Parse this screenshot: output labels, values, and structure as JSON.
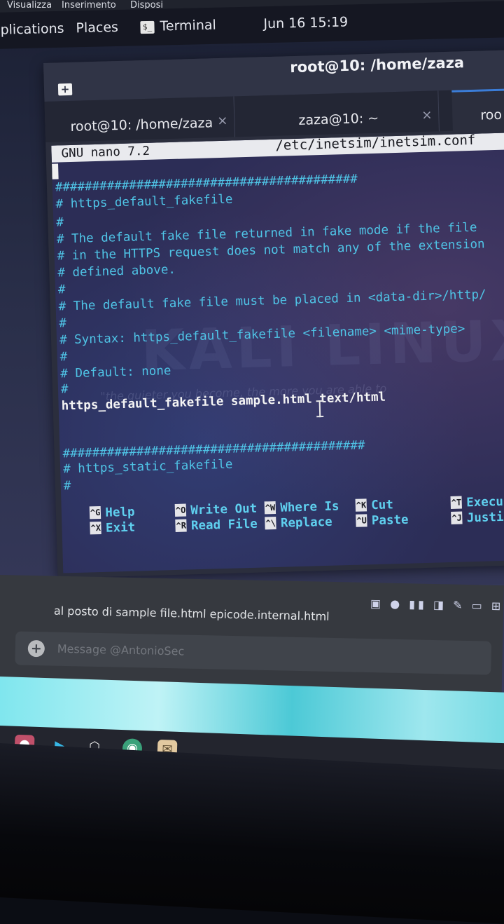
{
  "menu_strip": {
    "items": [
      "Visualizza",
      "Inserimento",
      "Disposi"
    ]
  },
  "top_panel": {
    "applications": "plications",
    "places": "Places",
    "terminal_icon": "$_",
    "terminal": "Terminal",
    "clock": "Jun 16  15:19"
  },
  "window": {
    "title": "root@10: /home/zaza",
    "tabs": [
      {
        "label": "root@10: /home/zaza",
        "close": "×"
      },
      {
        "label": "zaza@10: ~",
        "close": "×"
      },
      {
        "label": "roo",
        "close": ""
      }
    ]
  },
  "nano": {
    "version": "GNU nano 7.2",
    "file": "/etc/inetsim/inetsim.conf",
    "lines": [
      "#########################################",
      "# https_default_fakefile",
      "#",
      "# The default fake file returned in fake mode if the file",
      "# in the HTTPS request does not match any of the extension",
      "# defined above.",
      "#",
      "# The default fake file must be placed in <data-dir>/http/",
      "#",
      "# Syntax: https_default_fakefile <filename> <mime-type>",
      "#",
      "# Default: none",
      "#",
      "https_default_fakefile sample.html text/html",
      "",
      "#########################################",
      "# https_static_fakefile",
      "#"
    ],
    "watermark": "KALI LINUX",
    "watermark_sub": "\"the quieter you become, the more you are able to",
    "shortcuts": [
      {
        "key": "^G",
        "label": "Help"
      },
      {
        "key": "^X",
        "label": "Exit"
      },
      {
        "key": "^O",
        "label": "Write Out"
      },
      {
        "key": "^R",
        "label": "Read File"
      },
      {
        "key": "^W",
        "label": "Where Is"
      },
      {
        "key": "^\\",
        "label": "Replace"
      },
      {
        "key": "^K",
        "label": "Cut"
      },
      {
        "key": "^U",
        "label": "Paste"
      },
      {
        "key": "^T",
        "label": "Execu"
      },
      {
        "key": "^J",
        "label": "Justi"
      }
    ]
  },
  "chat": {
    "message": "al posto di sample file.html epicode.internal.html",
    "placeholder": "Message @AntonioSec",
    "plus": "+"
  },
  "taskbar": {
    "icons": [
      "browser-icon",
      "app-icon",
      "package-icon",
      "globe-icon",
      "files-icon"
    ]
  }
}
